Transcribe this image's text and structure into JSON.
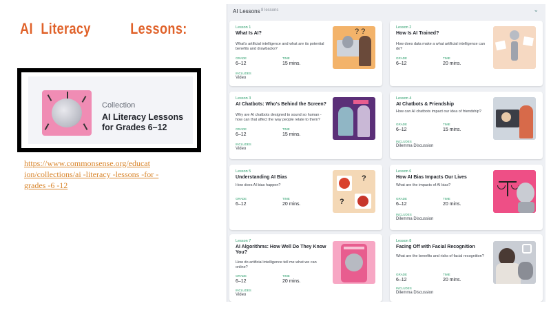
{
  "slide": {
    "title_words": [
      "AI",
      "Literacy",
      "Lessons:"
    ]
  },
  "collection": {
    "kicker": "Collection",
    "name": "AI Literacy Lessons for Grades 6–12"
  },
  "link_lines": [
    "https://www.commonsense.org/educat",
    "ion/collections/ai -literacy -lessons -for -",
    "grades -6 -12"
  ],
  "panel": {
    "title": "AI Lessons",
    "count": "8 lessons"
  },
  "labels": {
    "grades": "GRADE",
    "time": "TIME",
    "includes": "INCLUDES"
  },
  "lessons": [
    {
      "number": "Lesson 1",
      "title": "What Is AI?",
      "desc": "What's artificial intelligence and what are its potential benefits and drawbacks?",
      "grades": "6–12",
      "time": "15 mins.",
      "includes": "Video"
    },
    {
      "number": "Lesson 2",
      "title": "How Is AI Trained?",
      "desc": "How does data make a what artificial intelligence can do?",
      "grades": "6–12",
      "time": "20 mins.",
      "includes": ""
    },
    {
      "number": "Lesson 3",
      "title": "AI Chatbots: Who's Behind the Screen?",
      "desc": "Why are AI chatbots designed to sound so human - how can that affect the way people relate to them?",
      "grades": "6–12",
      "time": "15 mins.",
      "includes": "Video"
    },
    {
      "number": "Lesson 4",
      "title": "AI Chatbots & Friendship",
      "desc": "How can AI chatbots impact our idea of friendship?",
      "grades": "6–12",
      "time": "15 mins.",
      "includes": "Dilemma Discussion"
    },
    {
      "number": "Lesson 5",
      "title": "Understanding AI Bias",
      "desc": "How does AI bias happen?",
      "grades": "6–12",
      "time": "20 mins.",
      "includes": ""
    },
    {
      "number": "Lesson 6",
      "title": "How AI Bias Impacts Our Lives",
      "desc": "What are the impacts of AI bias?",
      "grades": "6–12",
      "time": "20 mins.",
      "includes": "Dilemma Discussion"
    },
    {
      "number": "Lesson 7",
      "title": "AI Algorithms: How Well Do They Know You?",
      "desc": "How do artificial intelligence tell me what we can online?",
      "grades": "6–12",
      "time": "20 mins.",
      "includes": "Video"
    },
    {
      "number": "Lesson 8",
      "title": "Facing Off with Facial Recognition",
      "desc": "What are the benefits and risks of facial recognition?",
      "grades": "6–12",
      "time": "20 mins.",
      "includes": "Dilemma Discussion"
    }
  ]
}
